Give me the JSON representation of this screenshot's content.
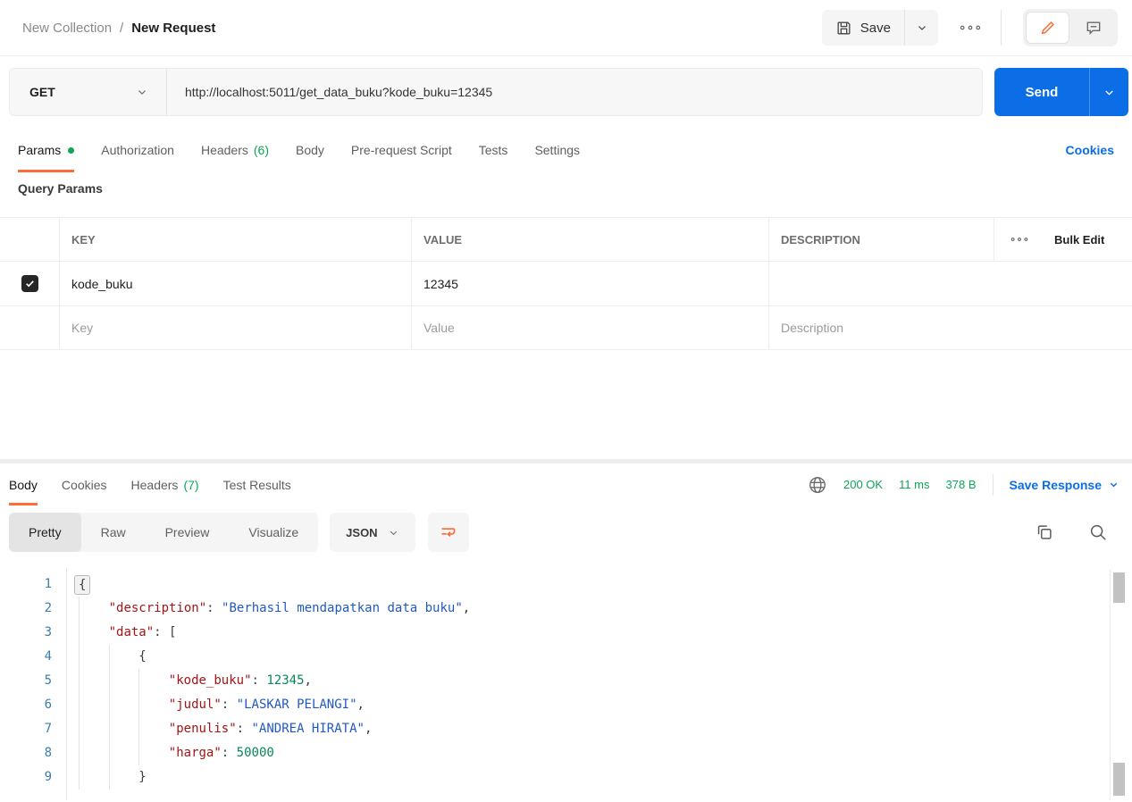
{
  "colors": {
    "accent_orange": "#FF6C37",
    "primary_blue": "#0B6EE7",
    "success_green": "#0FA558",
    "json_key": "#A31515",
    "json_string": "#2159C4",
    "json_number": "#098658",
    "line_number": "#3B7DAD"
  },
  "header": {
    "breadcrumb": {
      "collection": "New Collection",
      "separator": "/",
      "request": "New Request"
    },
    "save_label": "Save"
  },
  "request": {
    "method": "GET",
    "url": "http://localhost:5011/get_data_buku?kode_buku=12345",
    "send_label": "Send",
    "cookies_link": "Cookies",
    "query_params_label": "Query Params",
    "tabs": [
      {
        "label": "Params",
        "active": true,
        "dot": true
      },
      {
        "label": "Authorization"
      },
      {
        "label": "Headers",
        "count": "(6)"
      },
      {
        "label": "Body"
      },
      {
        "label": "Pre-request Script"
      },
      {
        "label": "Tests"
      },
      {
        "label": "Settings"
      }
    ],
    "table": {
      "columns": [
        "KEY",
        "VALUE",
        "DESCRIPTION"
      ],
      "bulk_edit_label": "Bulk Edit",
      "rows": [
        {
          "checked": true,
          "key": "kode_buku",
          "value": "12345",
          "description": ""
        }
      ],
      "placeholders": {
        "key": "Key",
        "value": "Value",
        "description": "Description"
      }
    }
  },
  "response": {
    "tabs": [
      {
        "label": "Body",
        "active": true
      },
      {
        "label": "Cookies"
      },
      {
        "label": "Headers",
        "count": "(7)"
      },
      {
        "label": "Test Results"
      }
    ],
    "status": {
      "code": "200 OK",
      "time": "11 ms",
      "size": "378 B"
    },
    "save_response_label": "Save Response",
    "view_tabs": [
      {
        "label": "Pretty",
        "active": true
      },
      {
        "label": "Raw"
      },
      {
        "label": "Preview"
      },
      {
        "label": "Visualize"
      }
    ],
    "format": "JSON",
    "code": {
      "lines": [
        {
          "n": 1,
          "indent": 0,
          "tokens": [
            {
              "t": "punc-hl",
              "v": "{"
            }
          ]
        },
        {
          "n": 2,
          "indent": 1,
          "tokens": [
            {
              "t": "key",
              "v": "\"description\""
            },
            {
              "t": "punc",
              "v": ": "
            },
            {
              "t": "str",
              "v": "\"Berhasil mendapatkan data buku\""
            },
            {
              "t": "punc",
              "v": ","
            }
          ]
        },
        {
          "n": 3,
          "indent": 1,
          "tokens": [
            {
              "t": "key",
              "v": "\"data\""
            },
            {
              "t": "punc",
              "v": ": ["
            }
          ]
        },
        {
          "n": 4,
          "indent": 2,
          "tokens": [
            {
              "t": "punc",
              "v": "{"
            }
          ]
        },
        {
          "n": 5,
          "indent": 3,
          "tokens": [
            {
              "t": "key",
              "v": "\"kode_buku\""
            },
            {
              "t": "punc",
              "v": ": "
            },
            {
              "t": "num",
              "v": "12345"
            },
            {
              "t": "punc",
              "v": ","
            }
          ]
        },
        {
          "n": 6,
          "indent": 3,
          "tokens": [
            {
              "t": "key",
              "v": "\"judul\""
            },
            {
              "t": "punc",
              "v": ": "
            },
            {
              "t": "str",
              "v": "\"LASKAR PELANGI\""
            },
            {
              "t": "punc",
              "v": ","
            }
          ]
        },
        {
          "n": 7,
          "indent": 3,
          "tokens": [
            {
              "t": "key",
              "v": "\"penulis\""
            },
            {
              "t": "punc",
              "v": ": "
            },
            {
              "t": "str",
              "v": "\"ANDREA HIRATA\""
            },
            {
              "t": "punc",
              "v": ","
            }
          ]
        },
        {
          "n": 8,
          "indent": 3,
          "tokens": [
            {
              "t": "key",
              "v": "\"harga\""
            },
            {
              "t": "punc",
              "v": ": "
            },
            {
              "t": "num",
              "v": "50000"
            }
          ]
        },
        {
          "n": 9,
          "indent": 2,
          "tokens": [
            {
              "t": "punc",
              "v": "}"
            }
          ]
        }
      ]
    }
  }
}
